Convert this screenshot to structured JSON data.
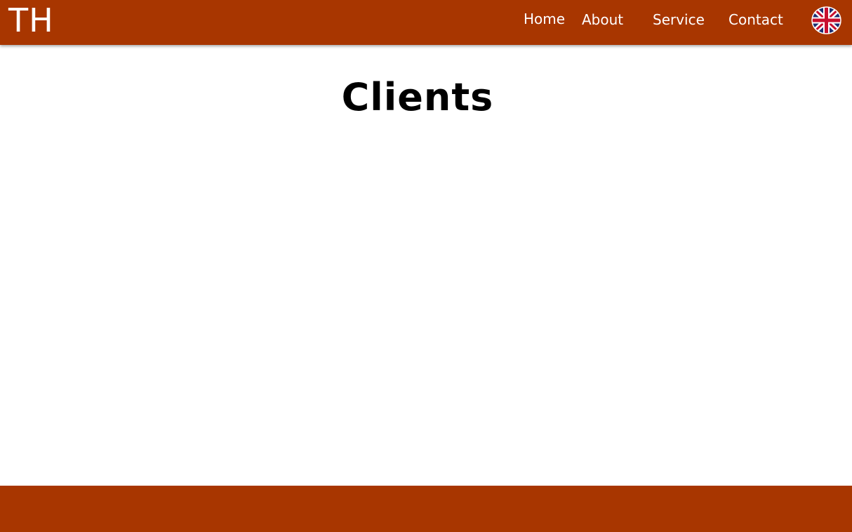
{
  "header": {
    "logo_text": "TH",
    "nav": {
      "home": "Home",
      "about": "About",
      "service": "Service",
      "contact": "Contact"
    },
    "language_icon": "uk-flag-icon"
  },
  "main": {
    "title": "Clients"
  },
  "colors": {
    "brand": "#a83600",
    "background": "#ffffff",
    "title_text": "#000000",
    "nav_text": "#ffffff"
  }
}
